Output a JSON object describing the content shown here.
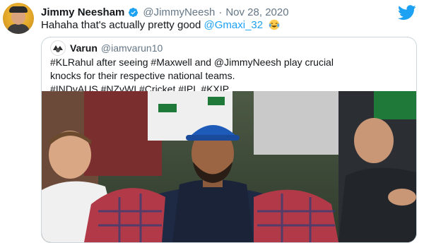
{
  "tweet": {
    "author_name": "Jimmy Neesham",
    "author_handle": "@JimmyNeesh",
    "separator": "·",
    "date": "Nov 28, 2020",
    "text_before_mention": "Hahaha that's actually pretty good ",
    "mention": "@Gmaxi_32",
    "emoji": "crying-laughing-emoji"
  },
  "quoted_tweet": {
    "author_name": "Varun",
    "author_handle": "@iamvarun10",
    "text_line1": "#KLRahul after seeing #Maxwell and @JimmyNeesh play crucial",
    "text_line2": "knocks for their respective national teams.",
    "text_line3": "#INDvAUS #NZvWI #Cricket #IPL #KXIP"
  },
  "colors": {
    "link": "#1da1f2",
    "secondary_text": "#657786",
    "border": "#ccd6dd"
  },
  "icons": {
    "verified": "verified-badge-icon",
    "logo": "twitter-bird-icon"
  }
}
